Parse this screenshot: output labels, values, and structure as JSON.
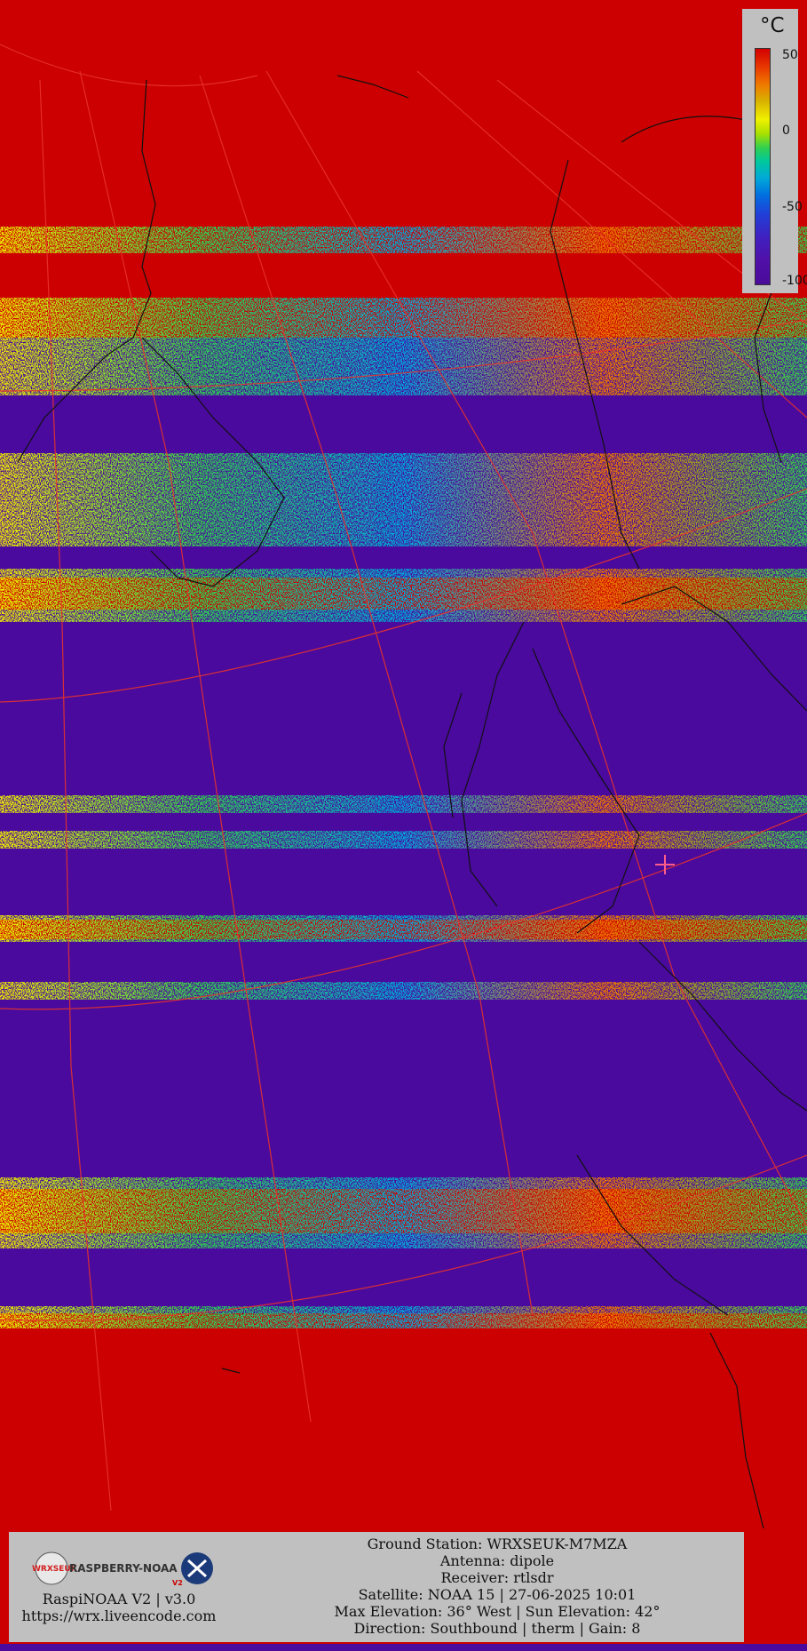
{
  "scale": {
    "unit": "°C",
    "ticks": [
      "50",
      "0",
      "-50",
      "-100"
    ]
  },
  "footer": {
    "logo_text_1": "WRXSEUK",
    "logo_text_2": "RASPBERRY-NOAA",
    "logo_text_3": "V2",
    "app_version": "RaspiNOAA V2 | v3.0",
    "url": "https://wrx.liveencode.com",
    "ground_station": "Ground Station: WRXSEUK-M7MZA",
    "antenna": "Antenna: dipole",
    "receiver": "Receiver: rtlsdr",
    "satellite": "Satellite: NOAA 15 | 27-06-2025 10:01",
    "elevation": "Max Elevation: 36° West | Sun Elevation: 42°",
    "direction": "Direction: Southbound | therm | Gain: 8"
  },
  "colors": {
    "hot": "#cc0000",
    "cold": "#4a0a9e",
    "panel": "#c0c0c0"
  }
}
